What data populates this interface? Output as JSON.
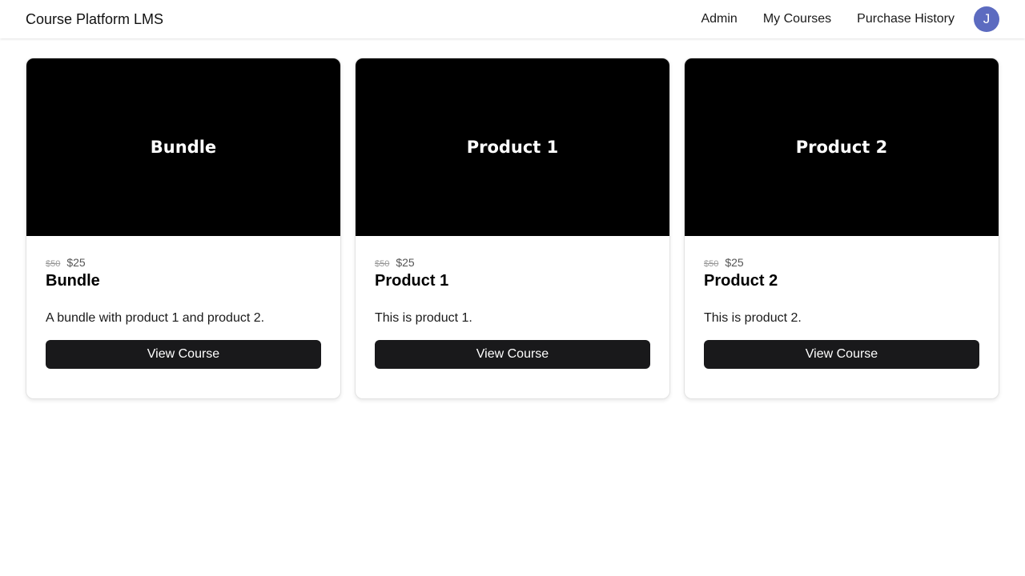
{
  "header": {
    "brand": "Course Platform LMS",
    "nav": {
      "admin": "Admin",
      "my_courses": "My Courses",
      "purchase_history": "Purchase History"
    },
    "avatar_initial": "J",
    "avatar_color": "#5c6bc0"
  },
  "courses": [
    {
      "image_label": "Bundle",
      "price_old": "$50",
      "price_new": "$25",
      "title": "Bundle",
      "description": "A bundle with product 1 and product 2.",
      "button_label": "View Course"
    },
    {
      "image_label": "Product 1",
      "price_old": "$50",
      "price_new": "$25",
      "title": "Product 1",
      "description": "This is product 1.",
      "button_label": "View Course"
    },
    {
      "image_label": "Product 2",
      "price_old": "$50",
      "price_new": "$25",
      "title": "Product 2",
      "description": "This is product 2.",
      "button_label": "View Course"
    }
  ]
}
